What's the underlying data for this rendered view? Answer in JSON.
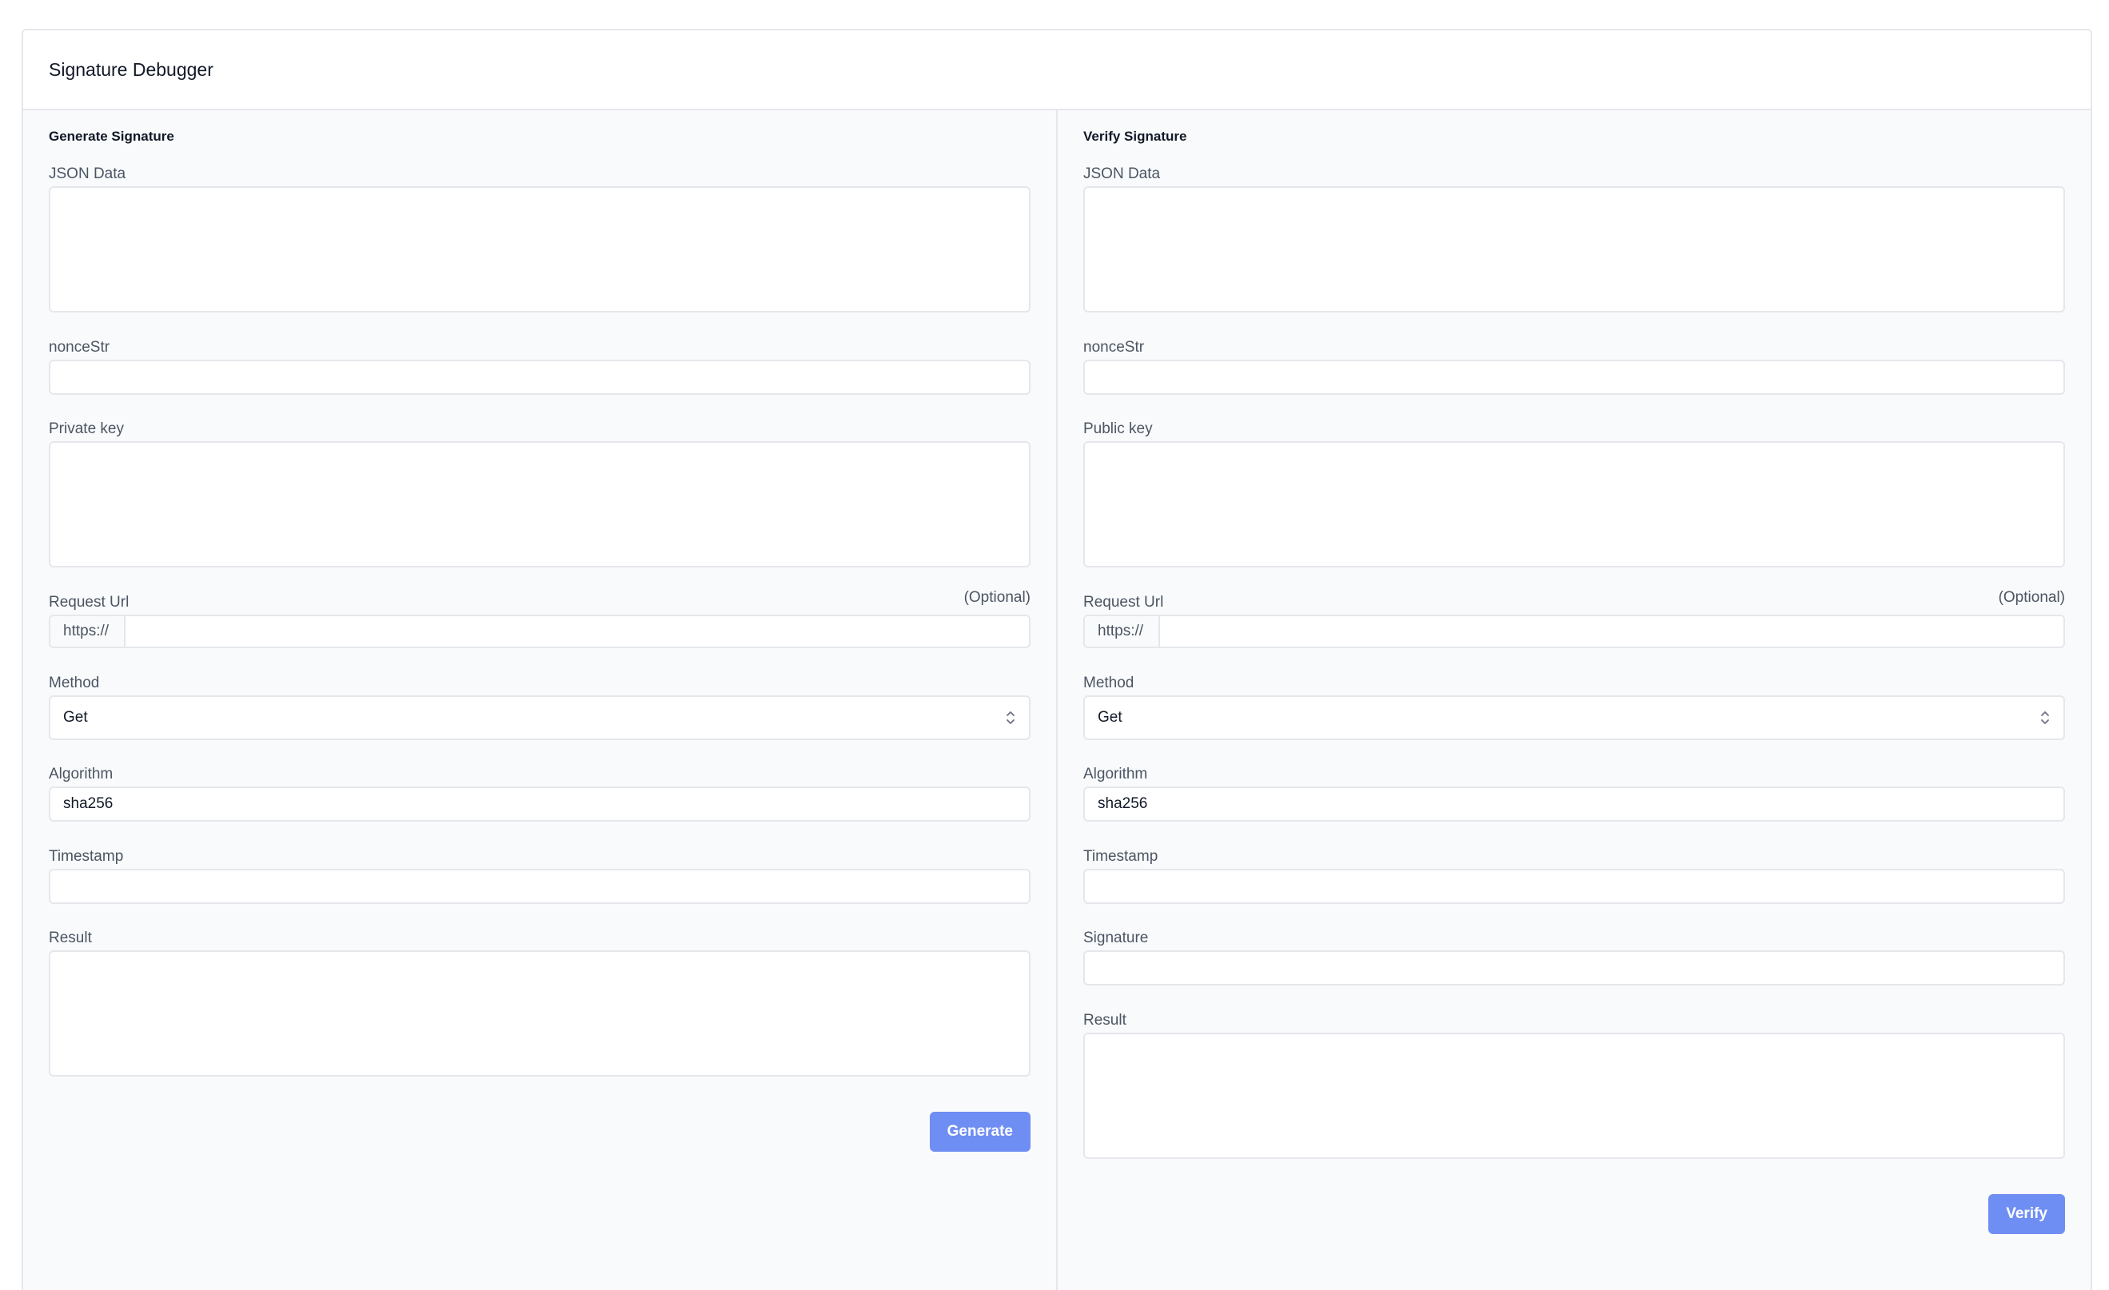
{
  "app": {
    "title": "Signature Debugger"
  },
  "generate": {
    "title": "Generate Signature",
    "json_label": "JSON Data",
    "nonce_label": "nonceStr",
    "key_label": "Private key",
    "url_label": "Request Url",
    "url_optional": "(Optional)",
    "url_prefix": "https://",
    "method_label": "Method",
    "method_value": "Get",
    "algorithm_label": "Algorithm",
    "algorithm_value": "sha256",
    "timestamp_label": "Timestamp",
    "result_label": "Result",
    "button_label": "Generate"
  },
  "verify": {
    "title": "Verify Signature",
    "json_label": "JSON Data",
    "nonce_label": "nonceStr",
    "key_label": "Public key",
    "url_label": "Request Url",
    "url_optional": "(Optional)",
    "url_prefix": "https://",
    "method_label": "Method",
    "method_value": "Get",
    "algorithm_label": "Algorithm",
    "algorithm_value": "sha256",
    "timestamp_label": "Timestamp",
    "signature_label": "Signature",
    "result_label": "Result",
    "button_label": "Verify"
  },
  "colors": {
    "primary_button": "#6f8ef3",
    "pane_background": "#f9fafb",
    "border": "#e5e7eb",
    "label_text": "#4b5563"
  },
  "icons": {
    "select_indicator": "chevron-up-down-icon"
  }
}
